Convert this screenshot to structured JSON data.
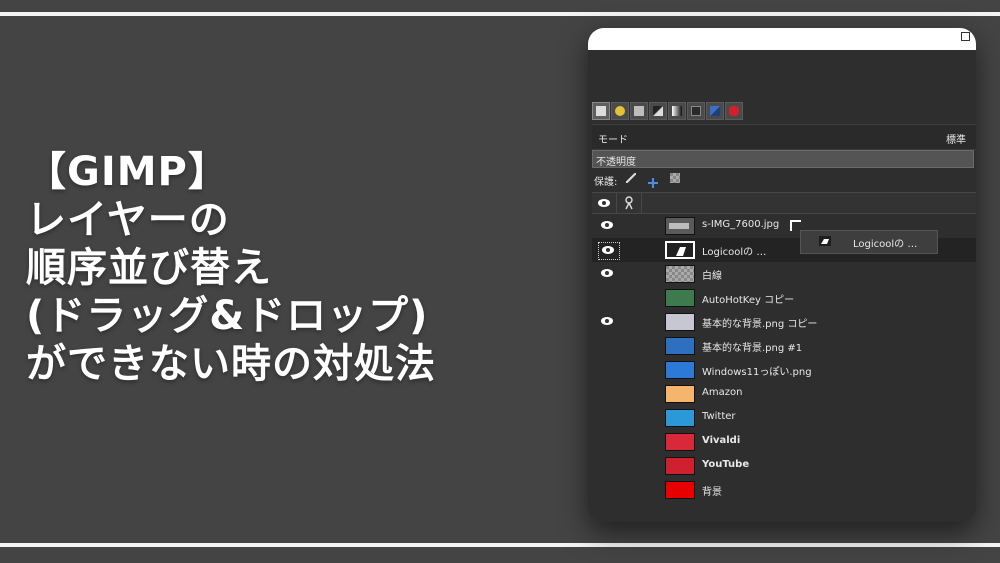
{
  "title_lines": [
    "【GIMP】",
    "レイヤーの",
    "順序並び替え",
    "(ドラッグ&ドロップ)",
    "ができない時の対処法"
  ],
  "gimp": {
    "mode_label": "モード",
    "mode_value": "標準",
    "opacity_label": "不透明度",
    "lock_label": "保護:",
    "drag_ghost_label": "Logicoolの …",
    "layers": [
      {
        "name": "s-IMG_7600.jpg",
        "visible": true,
        "thumb": "#5a5a5a",
        "bold": false,
        "selected": false
      },
      {
        "name": "Logicoolの …",
        "visible": true,
        "thumb": "#202020",
        "bold": false,
        "selected": true
      },
      {
        "name": "白線",
        "visible": true,
        "thumb": "checker",
        "bold": false,
        "selected": false
      },
      {
        "name": "AutoHotKey コピー",
        "visible": false,
        "thumb": "#3d7a4e",
        "bold": false,
        "selected": false
      },
      {
        "name": "基本的な背景.png コピー",
        "visible": true,
        "thumb": "#c7c7d2",
        "bold": false,
        "selected": false
      },
      {
        "name": "基本的な背景.png #1",
        "visible": false,
        "thumb": "#2f6fbf",
        "bold": false,
        "selected": false
      },
      {
        "name": "Windows11っぽい.png",
        "visible": false,
        "thumb": "#2d79d6",
        "bold": false,
        "selected": false
      },
      {
        "name": "Amazon",
        "visible": false,
        "thumb": "#f6b56c",
        "bold": false,
        "selected": false
      },
      {
        "name": "Twitter",
        "visible": false,
        "thumb": "#2b98d8",
        "bold": false,
        "selected": false
      },
      {
        "name": "Vivaldi",
        "visible": false,
        "thumb": "#d9283a",
        "bold": true,
        "selected": false
      },
      {
        "name": "YouTube",
        "visible": false,
        "thumb": "#cf2030",
        "bold": true,
        "selected": false
      },
      {
        "name": "背景",
        "visible": false,
        "thumb": "#e80000",
        "bold": false,
        "selected": false
      }
    ]
  },
  "colors": {
    "background": "#444444",
    "stripe": "#f4f4f4",
    "title_text": "#ffffff",
    "panel": "#2e2e2e"
  }
}
